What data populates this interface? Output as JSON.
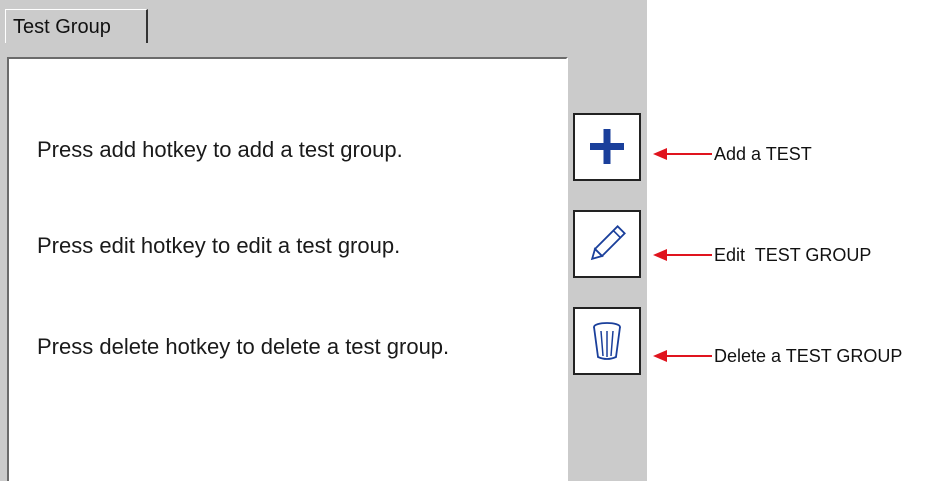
{
  "tab": {
    "label": "Test Group"
  },
  "panel": {
    "lines": [
      "Press add hotkey to add a test group.",
      "Press edit hotkey to edit a test group.",
      "Press delete hotkey to delete a test group."
    ]
  },
  "hotkeys": [
    {
      "icon": "plus-icon",
      "color": "#1a3f9b"
    },
    {
      "icon": "pencil-icon",
      "color": "#1a3f9b"
    },
    {
      "icon": "trash-bin-icon",
      "color": "#1a3f9b"
    }
  ],
  "callouts": [
    "Add a TEST",
    "Edit  TEST GROUP",
    "Delete a TEST GROUP"
  ],
  "colors": {
    "arrow": "#e0141e",
    "device_background": "#cbcbcb",
    "icon": "#1a3f9b"
  }
}
